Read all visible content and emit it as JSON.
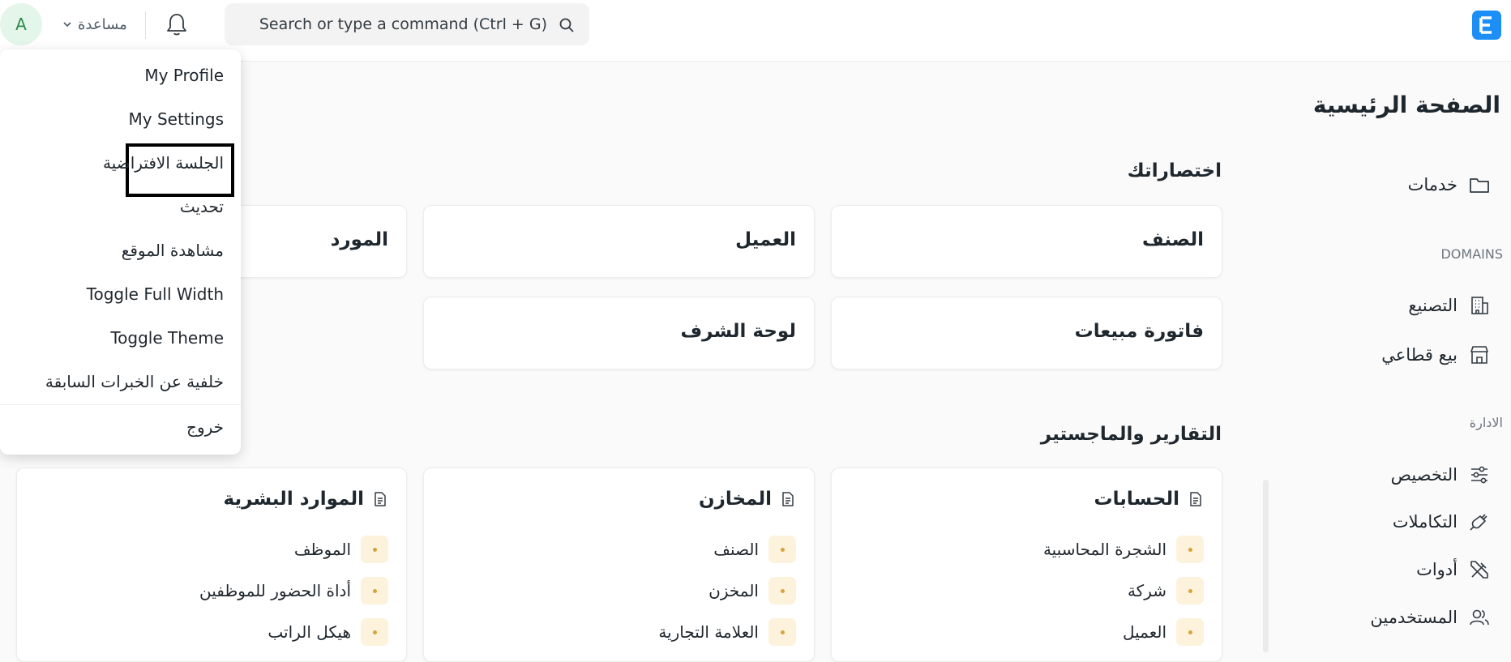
{
  "topbar": {
    "avatar_initial": "A",
    "help_label": "مساعدة",
    "search_placeholder": "Search or type a command (Ctrl + G)",
    "logo_letter": "E"
  },
  "page": {
    "title": "الصفحة الرئيسية"
  },
  "sidebar": {
    "items_top": [
      {
        "label": "خدمات",
        "icon": "folder-icon"
      }
    ],
    "domains_header": "DOMAINS",
    "domains": [
      {
        "label": "التصنيع",
        "icon": "building-icon"
      },
      {
        "label": "بيع قطاعي",
        "icon": "store-icon"
      }
    ],
    "admin_header": "الادارة",
    "admin": [
      {
        "label": "التخصيص",
        "icon": "sliders-icon"
      },
      {
        "label": "التكاملات",
        "icon": "plug-icon"
      },
      {
        "label": "أدوات",
        "icon": "tools-icon"
      },
      {
        "label": "المستخدمين",
        "icon": "users-icon"
      }
    ]
  },
  "shortcuts": {
    "title": "اختصاراتك",
    "items": [
      "الصنف",
      "العميل",
      "المورد",
      "فاتورة مبيعات",
      "لوحة الشرف"
    ]
  },
  "reports": {
    "title": "التقارير والماجستير",
    "cards": [
      {
        "title": "الحسابات",
        "links": [
          "الشجرة المحاسبية",
          "شركة",
          "العميل"
        ]
      },
      {
        "title": "المخازن",
        "links": [
          "الصنف",
          "المخزن",
          "العلامة التجارية"
        ]
      },
      {
        "title": "الموارد البشرية",
        "links": [
          "الموظف",
          "أداة الحضور للموظفين",
          "هيكل الراتب"
        ]
      }
    ]
  },
  "user_menu": {
    "items": [
      "My Profile",
      "My Settings",
      "الجلسة الافتراضية",
      "تحديث",
      "مشاهدة الموقع",
      "Toggle Full Width",
      "Toggle Theme",
      "خلفية عن الخبرات السابقة",
      "خروج"
    ],
    "highlighted": "My Settings"
  },
  "colors": {
    "brand": "#1d8ef5",
    "avatar_bg": "#e4f5e9",
    "avatar_fg": "#2f8a4e",
    "bullet_bg": "#fdf3dc",
    "bullet_dot": "#d6a33c"
  }
}
